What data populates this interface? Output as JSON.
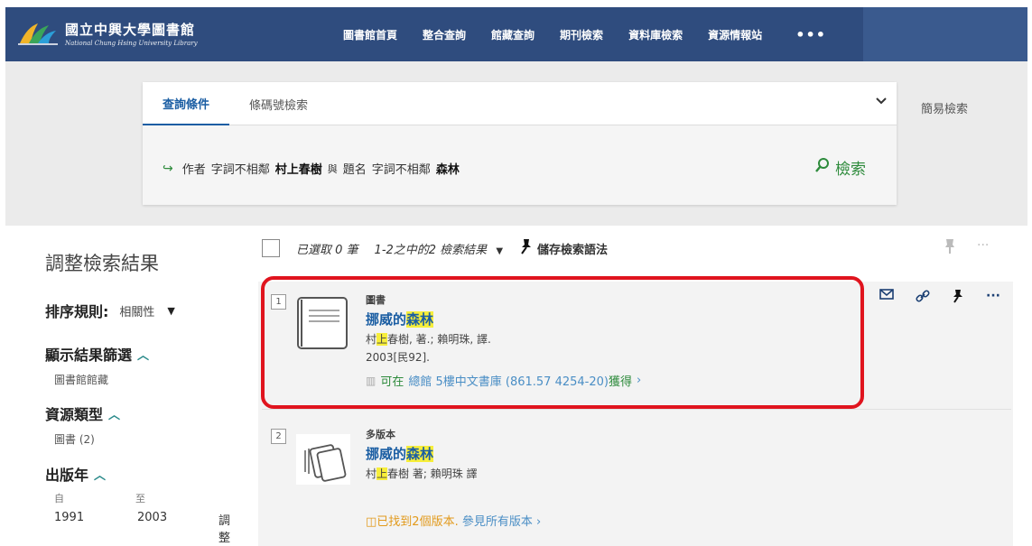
{
  "header": {
    "logo_title": "國立中興大學圖書館",
    "logo_subtitle": "National Chung Hsing University Library",
    "nav": [
      "圖書館首頁",
      "整合查詢",
      "館藏查詢",
      "期刊檢索",
      "資料庫檢索",
      "資源情報站"
    ],
    "nav_more": "•••"
  },
  "search": {
    "tabs": [
      "查詢條件",
      "條碼號檢索"
    ],
    "query": {
      "field1": "作者",
      "op1": "字詞不相鄰",
      "term1": "村上春樹",
      "connector": "與",
      "field2": "題名",
      "op2": "字詞不相鄰",
      "term2": "森林"
    },
    "search_button": "檢索",
    "simple_search": "簡易檢索"
  },
  "sidebar": {
    "title": "調整檢索結果",
    "sort_label": "排序規則:",
    "sort_value": "相關性",
    "facets": [
      {
        "heading": "顯示結果篩選",
        "value": "圖書館館藏"
      },
      {
        "heading": "資源類型",
        "value": "圖書 (2)"
      },
      {
        "heading": "出版年"
      }
    ],
    "year": {
      "from_label": "自",
      "to_label": "至",
      "from": "1991",
      "to": "2003",
      "adjust": "調整"
    }
  },
  "toolbar": {
    "selected": "已選取 0 筆",
    "count": "1-2之中的2 檢索結果",
    "save_query": "儲存檢索語法"
  },
  "results": [
    {
      "num": "1",
      "type": "圖書",
      "title_pre": "挪威的",
      "title_hl": "森林",
      "author_pre": "村",
      "author_hl": "上",
      "author_post": "春樹, 著.; 賴明珠, 譯.",
      "pub": "2003[民92].",
      "avail_prefix": "可在",
      "avail_location": "總館  5樓中文書庫 (861.57 4254-20)",
      "avail_suffix": "獲得"
    },
    {
      "num": "2",
      "type": "多版本",
      "title_pre": "挪威的",
      "title_hl": "森林",
      "author_pre": "村",
      "author_hl": "上",
      "author_post": "春樹 著; 賴明珠 譯",
      "versions_text": "已找到2個版本.",
      "versions_link": "參見所有版本"
    }
  ]
}
